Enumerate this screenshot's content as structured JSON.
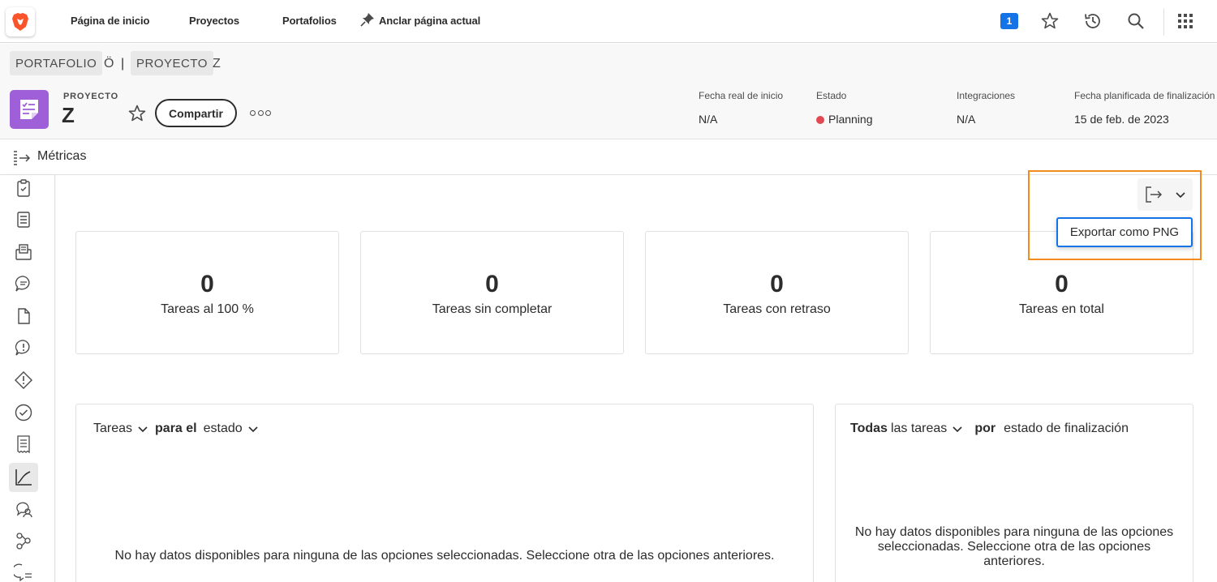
{
  "topnav": {
    "home": "Página de inicio",
    "projects": "Proyectos",
    "portfolios": "Portafolios",
    "pin": "Anclar página actual",
    "badge_count": "1"
  },
  "breadcrumb": {
    "portfolio_label": "PORTAFOLIO",
    "portfolio_name": "Ö",
    "separator": "|",
    "project_label": "PROYECTO",
    "project_name": "Z"
  },
  "header": {
    "kicker": "PROYECTO",
    "name": "Z",
    "share": "Compartir",
    "meta": [
      {
        "label": "Fecha real de inicio",
        "value": "N/A"
      },
      {
        "label": "Estado",
        "value": "Planning",
        "status_color": "#e34850"
      },
      {
        "label": "Integraciones",
        "value": "N/A"
      },
      {
        "label": "Fecha planificada de finalización",
        "value": "15 de feb. de 2023"
      }
    ]
  },
  "metrics": {
    "title": "Métricas",
    "export_option": "Exportar como PNG",
    "cards": [
      {
        "value": "0",
        "label": "Tareas al 100 %"
      },
      {
        "value": "0",
        "label": "Tareas sin completar"
      },
      {
        "value": "0",
        "label": "Tareas con retraso"
      },
      {
        "value": "0",
        "label": "Tareas en total"
      }
    ],
    "panel_left": {
      "select1": "Tareas",
      "connector": "para el",
      "select2": "estado",
      "empty": "No hay datos disponibles para ninguna de las opciones seleccionadas. Seleccione otra de las opciones anteriores."
    },
    "panel_right": {
      "select1_bold": "Todas",
      "select1_rest": "las tareas",
      "connector": "por",
      "select2": "estado de finalización",
      "empty_lines": [
        "No hay datos disponibles para ninguna de las opciones",
        "seleccionadas. Seleccione otra de las opciones",
        "anteriores."
      ]
    }
  },
  "colors": {
    "accent": "#1473e6",
    "project_icon": "#9e5fd9",
    "highlight": "#f28c1e"
  }
}
